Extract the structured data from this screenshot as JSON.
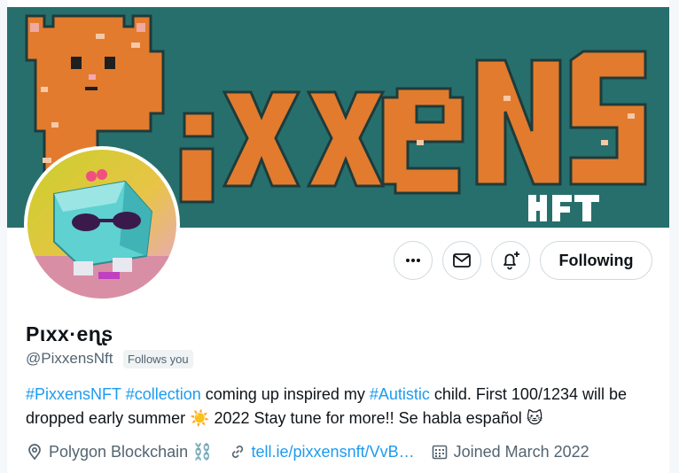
{
  "profile": {
    "display_name": "Pιxx·eɳʂ",
    "handle": "@PixxensNft",
    "follows_you": "Follows you",
    "bio": {
      "tag1": "#PixxensNFT",
      "tag2": "#collection",
      "text1": " coming up inspired my ",
      "tag3": "#Autistic",
      "text2": " child. First 100/1234 will be dropped early summer ☀️ 2022 Stay tune for more!! Se habla español 🐱"
    },
    "location": "Polygon Blockchain ⛓️",
    "website": "tell.ie/pixxensnft/VvB…",
    "joined": "Joined March 2022"
  },
  "banner": {
    "title": "Pixxens",
    "subtitle": "NFT",
    "background_color": "#276f6c",
    "letter_color": "#e27b2e"
  },
  "actions": {
    "more_icon": "more-horizontal-icon",
    "message_icon": "envelope-icon",
    "notify_icon": "bell-plus-icon",
    "following_label": "Following"
  },
  "icons": {
    "location": "map-pin-icon",
    "website": "link-icon",
    "joined": "calendar-icon"
  },
  "colors": {
    "link": "#1d9bf0",
    "secondary_text": "#536471"
  }
}
